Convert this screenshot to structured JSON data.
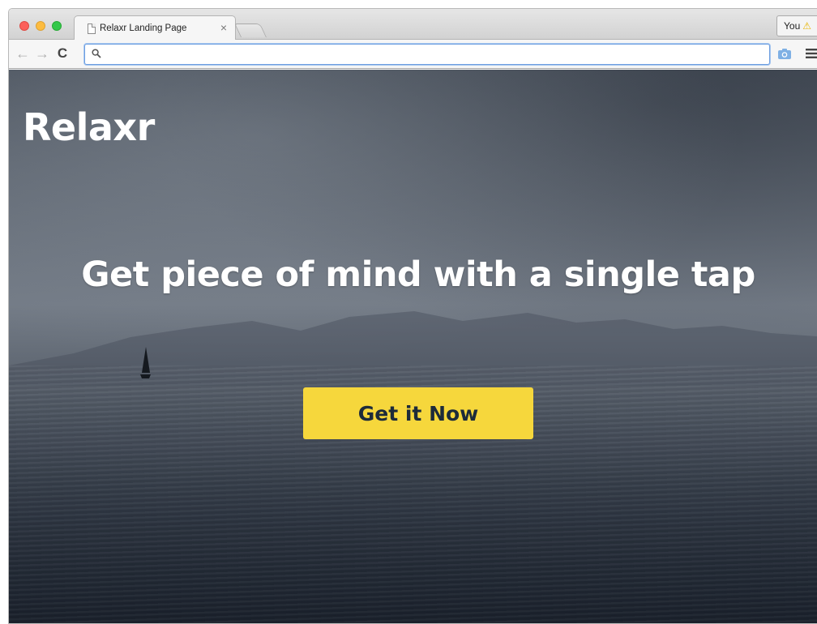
{
  "browser": {
    "tab_title": "Relaxr Landing Page",
    "tab_close": "×",
    "profile_label": "You",
    "profile_warning_icon": "warning-icon",
    "address_value": "",
    "nav_icons": [
      "back-arrow-icon",
      "forward-arrow-icon",
      "reload-icon"
    ]
  },
  "page": {
    "brand": "Relaxr",
    "headline": "Get piece of mind with a single tap",
    "cta_label": "Get it Now",
    "colors": {
      "cta_background": "#f6d73c",
      "cta_text": "#1d2b3a",
      "text": "#ffffff"
    }
  }
}
